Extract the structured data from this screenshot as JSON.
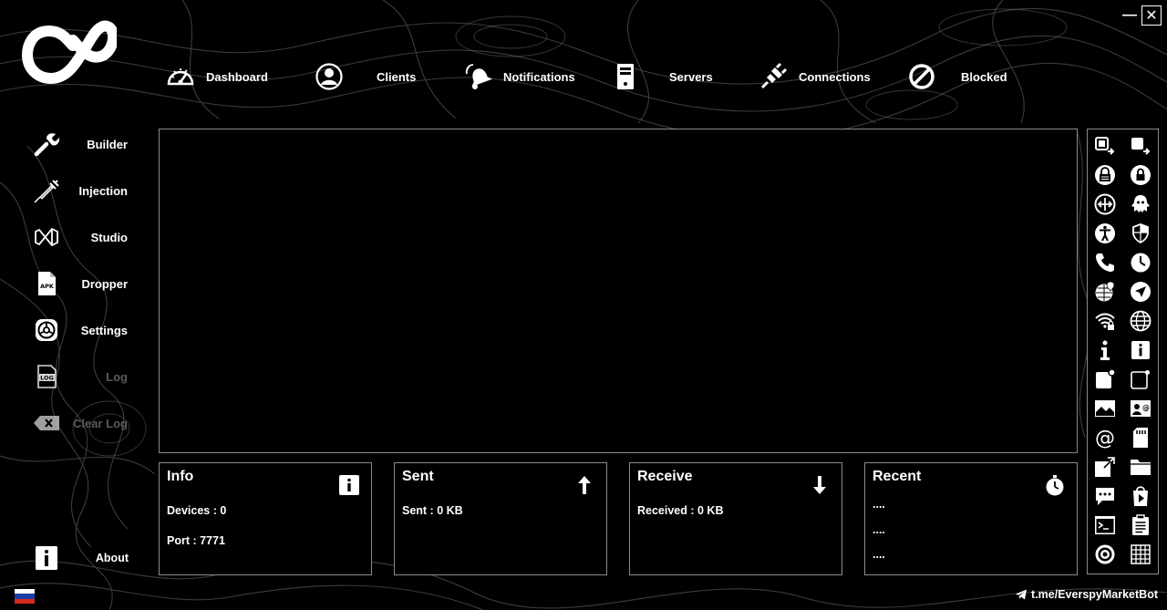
{
  "window": {
    "minimize_label": "—",
    "close_label": "✕"
  },
  "topnav": [
    {
      "id": "dashboard",
      "label": "Dashboard",
      "icon": "speedometer-icon"
    },
    {
      "id": "clients",
      "label": "Clients",
      "icon": "user-icon"
    },
    {
      "id": "notifications",
      "label": "Notifications",
      "icon": "bell-icon"
    },
    {
      "id": "servers",
      "label": "Servers",
      "icon": "server-icon"
    },
    {
      "id": "connections",
      "label": "Connections",
      "icon": "plug-icon"
    },
    {
      "id": "blocked",
      "label": "Blocked",
      "icon": "block-icon"
    }
  ],
  "sidebar": [
    {
      "id": "builder",
      "label": "Builder",
      "icon": "wrench-icon",
      "enabled": true
    },
    {
      "id": "injection",
      "label": "Injection",
      "icon": "syringe-icon",
      "enabled": true
    },
    {
      "id": "studio",
      "label": "Studio",
      "icon": "visual-studio-icon",
      "enabled": true
    },
    {
      "id": "dropper",
      "label": "Dropper",
      "icon": "apk-file-icon",
      "enabled": true
    },
    {
      "id": "settings",
      "label": "Settings",
      "icon": "settings-icon",
      "enabled": true
    },
    {
      "id": "log",
      "label": "Log",
      "icon": "log-file-icon",
      "enabled": false
    },
    {
      "id": "clear-log",
      "label": "Clear Log",
      "icon": "clear-icon",
      "enabled": false
    }
  ],
  "about": {
    "label": "About",
    "icon": "info-box-icon"
  },
  "cards": {
    "info": {
      "title": "Info",
      "icon": "info-icon",
      "devices": "Devices : 0",
      "port": "Port : 7771"
    },
    "sent": {
      "title": "Sent",
      "icon": "arrow-up-icon",
      "value": "Sent : 0 KB"
    },
    "receive": {
      "title": "Receive",
      "icon": "arrow-down-icon",
      "value": "Received : 0 KB"
    },
    "recent": {
      "title": "Recent",
      "icon": "stopwatch-icon",
      "items": [
        "....",
        "....",
        "...."
      ]
    }
  },
  "toolbar": [
    "screen-share-icon",
    "screen-record-icon",
    "lock-pattern-icon",
    "lock-icon",
    "arrows-icon",
    "ghost-icon",
    "accessibility-icon",
    "shield-icon",
    "phone-icon",
    "clock-icon",
    "globe-pin-icon",
    "navigation-icon",
    "wifi-lock-icon",
    "globe-icon",
    "info-letter-icon",
    "info-square-icon",
    "notification-square-icon",
    "notification-outline-icon",
    "image-icon",
    "contact-card-icon",
    "at-sign-icon",
    "sd-card-icon",
    "open-external-icon",
    "folder-icon",
    "chat-icon",
    "play-store-icon",
    "terminal-icon",
    "clipboard-icon",
    "target-icon",
    "keypad-icon"
  ],
  "footer": {
    "telegram": "t.me/EverspyMarketBot",
    "language_flag": "russia-flag"
  },
  "colors": {
    "background": "#000000",
    "border": "#8a8a8a",
    "text": "#ffffff",
    "disabled": "#5a5a5a"
  }
}
